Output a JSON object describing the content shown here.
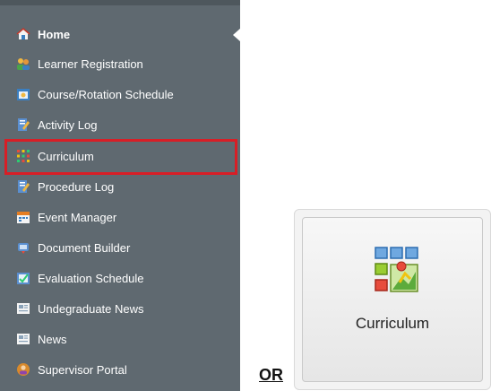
{
  "sidebar": {
    "items": [
      {
        "label": "Home",
        "icon": "home-icon"
      },
      {
        "label": "Learner Registration",
        "icon": "learners-icon"
      },
      {
        "label": "Course/Rotation Schedule",
        "icon": "schedule-icon"
      },
      {
        "label": "Activity Log",
        "icon": "activity-log-icon"
      },
      {
        "label": "Curriculum",
        "icon": "curriculum-grid-icon"
      },
      {
        "label": "Procedure Log",
        "icon": "procedure-log-icon"
      },
      {
        "label": "Event Manager",
        "icon": "event-manager-icon"
      },
      {
        "label": "Document Builder",
        "icon": "document-builder-icon"
      },
      {
        "label": "Evaluation Schedule",
        "icon": "evaluation-schedule-icon"
      },
      {
        "label": "Undegraduate News",
        "icon": "news-icon"
      },
      {
        "label": "News",
        "icon": "news-icon"
      },
      {
        "label": "Supervisor Portal",
        "icon": "supervisor-portal-icon"
      }
    ],
    "active_item": "Home",
    "highlighted_item": "Curriculum",
    "background_color": "#5f6970",
    "highlight_color": "#d81e26"
  },
  "separator": {
    "text": "OR"
  },
  "tile": {
    "label": "Curriculum",
    "icon": "curriculum-tile-icon"
  }
}
